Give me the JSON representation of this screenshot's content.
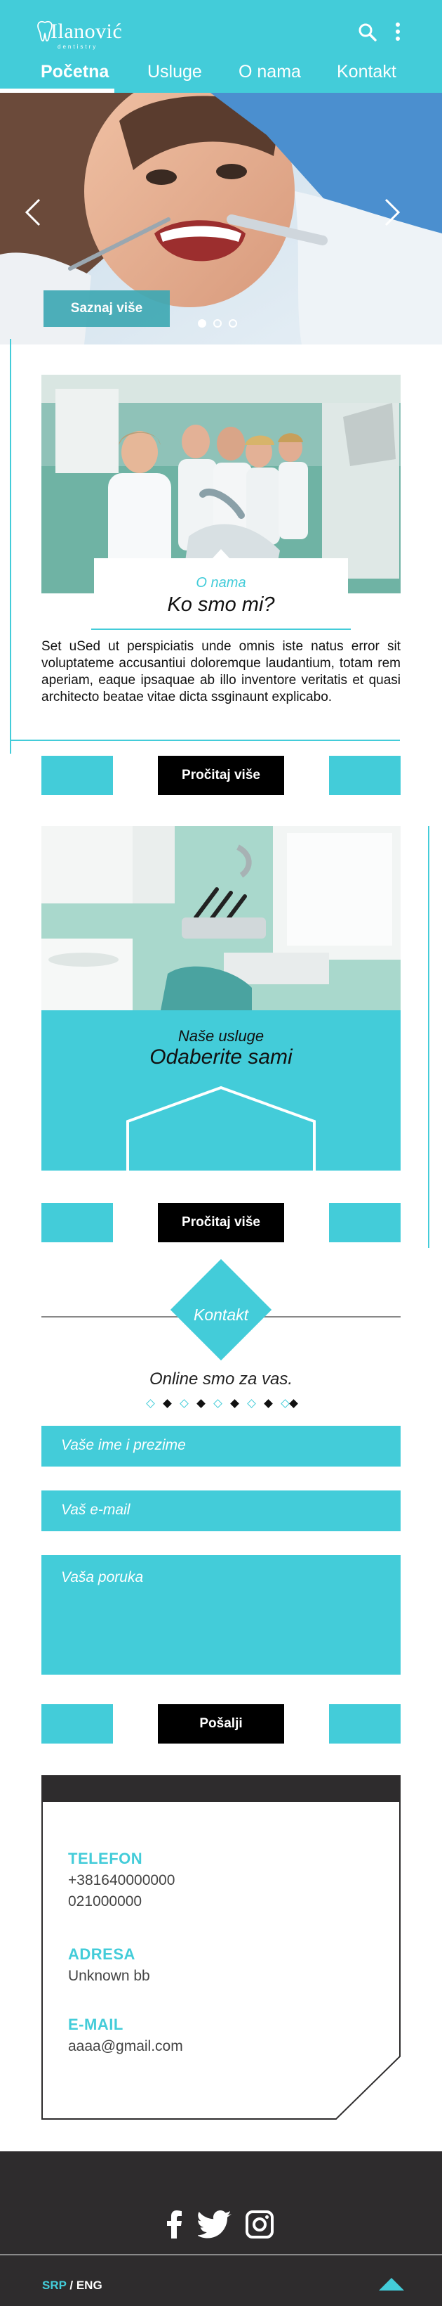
{
  "brand": {
    "name": "Ilanović",
    "tagline": "dentistry",
    "accent_color": "#43ccd9",
    "logo_icon": "tooth-icon"
  },
  "header": {
    "search_icon": "search-icon",
    "menu_icon": "more-vertical-icon",
    "nav": [
      {
        "label": "Početna",
        "active": true
      },
      {
        "label": "Usluge",
        "active": false
      },
      {
        "label": "O nama",
        "active": false
      },
      {
        "label": "Kontakt",
        "active": false
      }
    ]
  },
  "hero": {
    "button_label": "Saznaj više",
    "slides_total": 3,
    "active_slide": 1,
    "prev_icon": "chevron-left-icon",
    "next_icon": "chevron-right-icon"
  },
  "about": {
    "kicker": "O nama",
    "title": "Ko smo mi?",
    "text": "Set uSed ut perspiciatis unde omnis iste natus error sit voluptateme accusantiui doloremque laudantium, totam rem aperiam, eaque ipsaquae ab illo inventore veritatis et quasi architecto beatae vitae dicta ssginaunt explicabo.",
    "button_label": "Pročitaj više"
  },
  "services": {
    "kicker": "Naše usluge",
    "title": "Odaberite sami",
    "button_label": "Pročitaj više"
  },
  "contact": {
    "label": "Kontakt",
    "subtitle": "Online smo za vas.",
    "name_placeholder": "Vaše ime i prezime",
    "email_placeholder": "Vaš e-mail",
    "message_placeholder": "Vaša poruka",
    "submit_label": "Pošalji"
  },
  "info": {
    "phone_heading": "TELEFON",
    "phone_1": "+381640000000",
    "phone_2": "021000000",
    "address_heading": "ADRESA",
    "address": "Unknown bb",
    "email_heading": "E-MAIL",
    "email": "aaaa@gmail.com"
  },
  "footer": {
    "social_icons": [
      "facebook-icon",
      "twitter-icon",
      "instagram-icon"
    ],
    "lang_selected": "SRP",
    "lang_separator": " / ",
    "lang_other": "ENG",
    "to_top_icon": "triangle-up-icon"
  }
}
